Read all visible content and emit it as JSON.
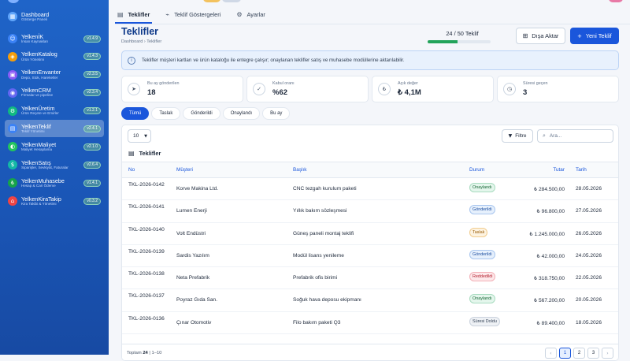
{
  "sidebar": {
    "items": [
      {
        "title": "Dashboard",
        "sub": "Gösterge Paneli",
        "version": "",
        "color": "#60a5fa",
        "glyph": "▦",
        "active": false
      },
      {
        "title": "YelkenİK",
        "sub": "İnsan Kaynakları",
        "version": "v1.4.9",
        "color": "#3b82f6",
        "glyph": "☺",
        "active": false
      },
      {
        "title": "YelkenKatalog",
        "sub": "Ürün Yönetimi",
        "version": "v1.4.3",
        "color": "#f59e0b",
        "glyph": "◈",
        "active": false
      },
      {
        "title": "YelkenEnvanter",
        "sub": "Depo, Stok, Hareketler",
        "version": "v2.3.5",
        "color": "#8b5cf6",
        "glyph": "▣",
        "active": false
      },
      {
        "title": "YelkenCRM",
        "sub": "Firmalar ve pipeline",
        "version": "v2.3.4",
        "color": "#6366f1",
        "glyph": "◉",
        "active": false
      },
      {
        "title": "YelkenÜretim",
        "sub": "Ürün Reçete ve Emirler",
        "version": "v1.2.1",
        "color": "#10b981",
        "glyph": "⚙",
        "active": false
      },
      {
        "title": "YelkenTeklif",
        "sub": "Teklif Yönetimi",
        "version": "v2.4.1",
        "color": "#3b82f6",
        "glyph": "▤",
        "active": true
      },
      {
        "title": "YelkenMaliyet",
        "sub": "Maliyet Hesaplama",
        "version": "v2.1.0",
        "color": "#22c55e",
        "glyph": "◐",
        "active": false
      },
      {
        "title": "YelkenSatış",
        "sub": "Siparişler, Sevkiyat, Faturalar",
        "version": "v2.6.4",
        "color": "#14b8a6",
        "glyph": "$",
        "active": false
      },
      {
        "title": "YelkenMuhasebe",
        "sub": "Hesap & Cari Ödeme",
        "version": "v1.4.1",
        "color": "#16a34a",
        "glyph": "₺",
        "active": false
      },
      {
        "title": "YelkenKiraTakip",
        "sub": "Kira Takibi & Yönetimi",
        "version": "v0.3.2",
        "color": "#ef4444",
        "glyph": "⌂",
        "active": false
      }
    ]
  },
  "tabs": [
    {
      "label": "Teklifler",
      "icon": "▤",
      "active": true
    },
    {
      "label": "Teklif Göstergeleri",
      "icon": "⌁",
      "active": false
    },
    {
      "label": "Ayarlar",
      "icon": "⚙",
      "active": false
    }
  ],
  "header": {
    "title": "Teklifler",
    "breadcrumb": "Dashboard  ›  Teklifler",
    "quota_text": "24 / 50 Teklif",
    "quota_fraction": 0.48,
    "export_label": "Dışa Aktar",
    "new_label": "Yeni Teklif"
  },
  "info": {
    "text": "Teklifler müşteri kartları ve ürün kataloğu ile entegre çalışır; onaylanan teklifler satış ve muhasebe modüllerine aktarılabilir."
  },
  "stats": [
    {
      "label": "Bu ay gönderilen",
      "value": "18",
      "icon": "➤"
    },
    {
      "label": "Kabul oranı",
      "value": "%62",
      "icon": "✓"
    },
    {
      "label": "Açık değer",
      "value": "₺ 4,1M",
      "icon": "₺"
    },
    {
      "label": "Süresi geçen",
      "value": "3",
      "icon": "◷"
    }
  ],
  "filters": [
    "Tümü",
    "Taslak",
    "Gönderildi",
    "Onaylandı",
    "Bu ay"
  ],
  "table": {
    "page_size": "10",
    "filter_label": "Filtre",
    "search_placeholder": "Ara...",
    "title": "Teklifler",
    "columns": {
      "no": "No",
      "customer": "Müşteri",
      "title": "Başlık",
      "status": "Durum",
      "amount": "Tutar",
      "date": "Tarih"
    },
    "rows": [
      {
        "no": "TKL-2026-0142",
        "customer": "Korve Makina Ltd.",
        "title": "CNC tezgah kurulum paketi",
        "status": "Onaylandı",
        "status_type": "approved",
        "amount": "₺ 284.500,00",
        "date": "28.05.2026"
      },
      {
        "no": "TKL-2026-0141",
        "customer": "Lumen Enerji",
        "title": "Yıllık bakım sözleşmesi",
        "status": "Gönderildi",
        "status_type": "sent",
        "amount": "₺ 96.800,00",
        "date": "27.05.2026"
      },
      {
        "no": "TKL-2026-0140",
        "customer": "Volt Endüstri",
        "title": "Güneş paneli montaj teklifi",
        "status": "Taslak",
        "status_type": "draft",
        "amount": "₺ 1.245.000,00",
        "date": "26.05.2026"
      },
      {
        "no": "TKL-2026-0139",
        "customer": "Sardis Yazılım",
        "title": "Modül lisans yenileme",
        "status": "Gönderildi",
        "status_type": "sent",
        "amount": "₺ 42.000,00",
        "date": "24.05.2026"
      },
      {
        "no": "TKL-2026-0138",
        "customer": "Neta Prefabrik",
        "title": "Prefabrik ofis birimi",
        "status": "Reddedildi",
        "status_type": "rejected",
        "amount": "₺ 318.750,00",
        "date": "22.05.2026"
      },
      {
        "no": "TKL-2026-0137",
        "customer": "Poyraz Gıda San.",
        "title": "Soğuk hava deposu ekipmanı",
        "status": "Onaylandı",
        "status_type": "approved",
        "amount": "₺ 567.200,00",
        "date": "20.05.2026"
      },
      {
        "no": "TKL-2026-0136",
        "customer": "Çınar Otomotiv",
        "title": "Filo bakım paketi Q3",
        "status": "Süresi Doldu",
        "status_type": "expired",
        "amount": "₺ 89.400,00",
        "date": "18.05.2026"
      }
    ]
  },
  "footer": {
    "total_prefix": "Toplam",
    "total_count": "24",
    "total_range": "| 1–10",
    "pages": [
      "1",
      "2",
      "3"
    ]
  }
}
